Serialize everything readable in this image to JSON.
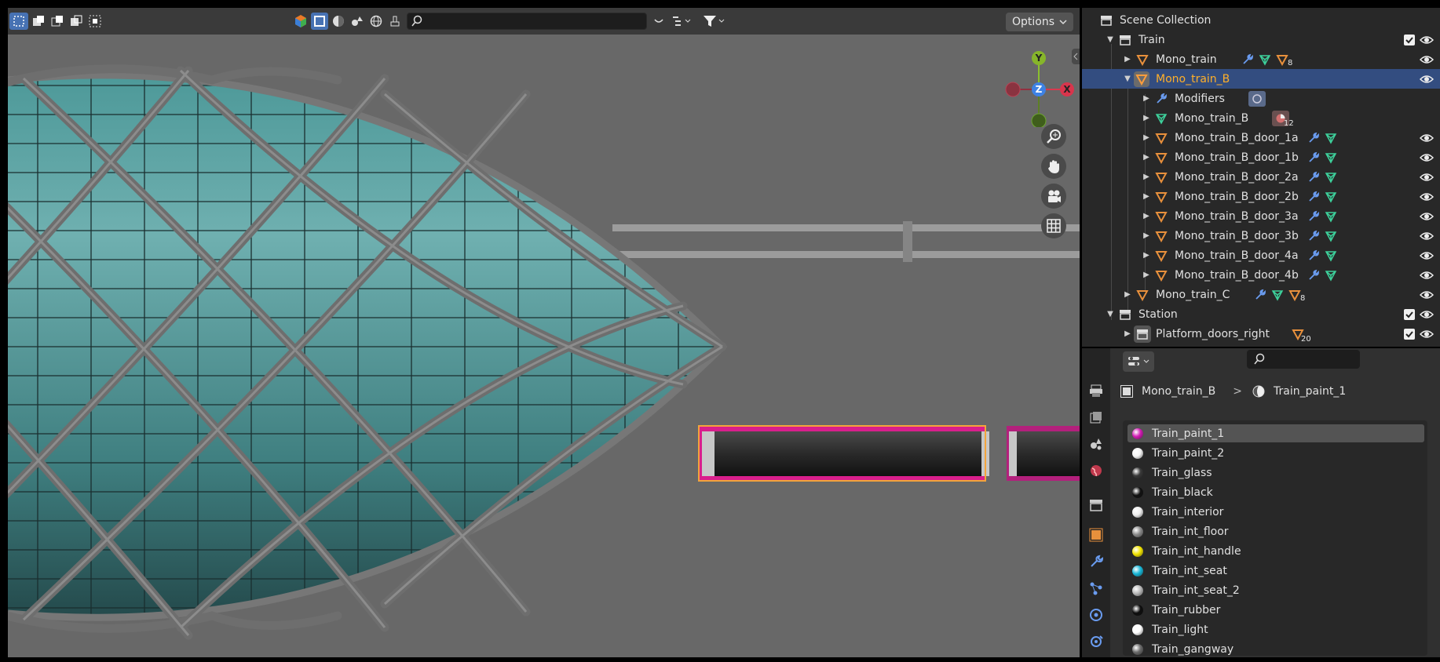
{
  "viewport": {
    "header": {
      "search_placeholder": "",
      "options_label": "Options"
    },
    "gizmo": {
      "y": "Y",
      "z": "Z",
      "x": "X"
    },
    "nav_icons": [
      "zoom-icon",
      "hand-pan-icon",
      "camera-icon",
      "grid-ortho-icon"
    ]
  },
  "outliner": {
    "rows": [
      {
        "label": "Scene Collection",
        "type": "scene-collection"
      },
      {
        "label": "Train",
        "type": "collection"
      },
      {
        "label": "Mono_train",
        "type": "object",
        "badge": "8"
      },
      {
        "label": "Mono_train_B",
        "type": "object",
        "selected": true
      },
      {
        "label": "Modifiers",
        "type": "modifiers"
      },
      {
        "label": "Mono_train_B",
        "type": "mesh-data",
        "badge": "12"
      },
      {
        "label": "Mono_train_B_door_1a",
        "type": "child"
      },
      {
        "label": "Mono_train_B_door_1b",
        "type": "child"
      },
      {
        "label": "Mono_train_B_door_2a",
        "type": "child"
      },
      {
        "label": "Mono_train_B_door_2b",
        "type": "child"
      },
      {
        "label": "Mono_train_B_door_3a",
        "type": "child"
      },
      {
        "label": "Mono_train_B_door_3b",
        "type": "child"
      },
      {
        "label": "Mono_train_B_door_4a",
        "type": "child"
      },
      {
        "label": "Mono_train_B_door_4b",
        "type": "child"
      },
      {
        "label": "Mono_train_C",
        "type": "object",
        "badge": "8"
      },
      {
        "label": "Station",
        "type": "collection"
      },
      {
        "label": "Platform_doors_right",
        "type": "collection-inst",
        "badge": "20"
      }
    ]
  },
  "properties": {
    "search_placeholder": "",
    "breadcrumb": {
      "object": "Mono_train_B",
      "separator": ">",
      "material": "Train_paint_1"
    },
    "materials": [
      {
        "name": "Train_paint_1",
        "color": "#d21bb4",
        "selected": true
      },
      {
        "name": "Train_paint_2",
        "color": "#f4f4f4"
      },
      {
        "name": "Train_glass",
        "color": "#3a3a3a"
      },
      {
        "name": "Train_black",
        "color": "#111111"
      },
      {
        "name": "Train_interior",
        "color": "#eeeeee"
      },
      {
        "name": "Train_int_floor",
        "color": "#8a8a8a"
      },
      {
        "name": "Train_int_handle",
        "color": "#f2e400"
      },
      {
        "name": "Train_int_seat",
        "color": "#17b7d8"
      },
      {
        "name": "Train_int_seat_2",
        "color": "#b9b9b9"
      },
      {
        "name": "Train_rubber",
        "color": "#0d0d0d"
      },
      {
        "name": "Train_light",
        "color": "#ffffff"
      },
      {
        "name": "Train_gangway",
        "color": "#6a6a6a"
      }
    ]
  },
  "colors": {
    "selection_blue": "#334d80",
    "active_orange": "#ffaf29",
    "modifier_blue": "#6a9cf0",
    "mesh_green": "#3dd09b",
    "object_orange": "#e8903c"
  }
}
